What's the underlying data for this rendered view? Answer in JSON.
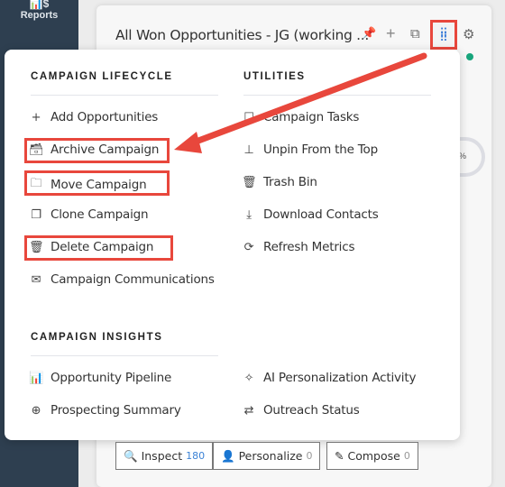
{
  "sidebar": {
    "reports_label": "Reports",
    "reports_icon": "reports-icon"
  },
  "header": {
    "title": "All Won Opportunities - JG (working ...",
    "status_color": "#18a57c"
  },
  "menu": {
    "lifecycle_heading": "CAMPAIGN LIFECYCLE",
    "utilities_heading": "UTILITIES",
    "insights_heading": "CAMPAIGN INSIGHTS",
    "lifecycle": [
      {
        "label": "Add Opportunities",
        "icon": "plus-icon"
      },
      {
        "label": "Archive Campaign",
        "icon": "archive-icon"
      },
      {
        "label": "Move Campaign",
        "icon": "folder-icon"
      },
      {
        "label": "Clone Campaign",
        "icon": "clone-icon"
      },
      {
        "label": "Delete Campaign",
        "icon": "trash-icon"
      },
      {
        "label": "Campaign Communications",
        "icon": "envelope-icon"
      }
    ],
    "utilities": [
      {
        "label": "Campaign Tasks",
        "icon": "tasks-icon"
      },
      {
        "label": "Unpin From the Top",
        "icon": "pin-icon"
      },
      {
        "label": "Trash Bin",
        "icon": "trash-bin-icon"
      },
      {
        "label": "Download Contacts",
        "icon": "download-icon"
      },
      {
        "label": "Refresh Metrics",
        "icon": "refresh-icon"
      }
    ],
    "insights": [
      {
        "label": "Opportunity Pipeline",
        "icon": "chart-icon"
      },
      {
        "label": "AI Personalization Activity",
        "icon": "sparkle-icon"
      },
      {
        "label": "Prospecting Summary",
        "icon": "crosshair-icon"
      },
      {
        "label": "Outreach Status",
        "icon": "outreach-icon"
      }
    ]
  },
  "ring_text": "%",
  "actions": [
    {
      "label": "Inspect",
      "count": "180"
    },
    {
      "label": "Personalize",
      "count": "0"
    },
    {
      "label": "Compose",
      "count": "0"
    }
  ],
  "annotation_color": "#e8473c"
}
